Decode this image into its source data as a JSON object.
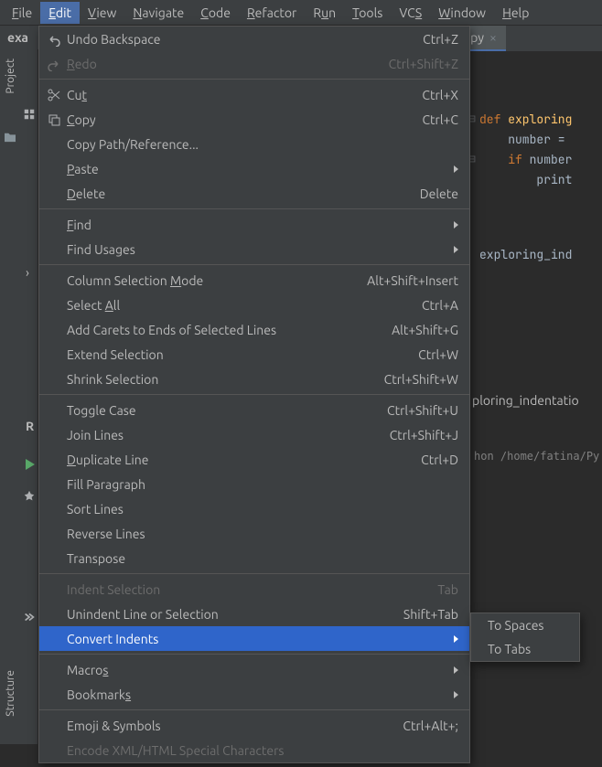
{
  "menubar": {
    "items": [
      {
        "label": "File",
        "mn": 0
      },
      {
        "label": "Edit",
        "mn": 0
      },
      {
        "label": "View",
        "mn": 0
      },
      {
        "label": "Navigate",
        "mn": 0
      },
      {
        "label": "Code",
        "mn": 0
      },
      {
        "label": "Refactor",
        "mn": 0
      },
      {
        "label": "Run",
        "mn": 1
      },
      {
        "label": "Tools",
        "mn": 0
      },
      {
        "label": "VCS",
        "mn": 2
      },
      {
        "label": "Window",
        "mn": 0
      },
      {
        "label": "Help",
        "mn": 0
      }
    ]
  },
  "breadcrumb": "exa",
  "sidebar": {
    "project": "Project",
    "structure": "Structure"
  },
  "tab": {
    "filename": "main.py"
  },
  "code": {
    "l1a": "def ",
    "l1b": "exploring",
    "l2": "    number = ",
    "l3a": "    if ",
    "l3b": "number",
    "l4": "        print",
    "call": "exploring_ind"
  },
  "run": {
    "label": "ploring_indentatio",
    "path": "hon /home/fatina/Py"
  },
  "edit_menu": {
    "undo": "Undo Backspace",
    "undo_sc": "Ctrl+Z",
    "redo": "Redo",
    "redo_sc": "Ctrl+Shift+Z",
    "cut": "Cut",
    "cut_sc": "Ctrl+X",
    "copy": "Copy",
    "copy_sc": "Ctrl+C",
    "copy_path": "Copy Path/Reference...",
    "paste": "Paste",
    "delete": "Delete",
    "delete_sc": "Delete",
    "find": "Find",
    "find_usages": "Find Usages",
    "col_sel": "Column Selection Mode",
    "col_sel_sc": "Alt+Shift+Insert",
    "sel_all": "Select All",
    "sel_all_sc": "Ctrl+A",
    "add_carets": "Add Carets to Ends of Selected Lines",
    "add_carets_sc": "Alt+Shift+G",
    "ext_sel": "Extend Selection",
    "ext_sel_sc": "Ctrl+W",
    "shr_sel": "Shrink Selection",
    "shr_sel_sc": "Ctrl+Shift+W",
    "toggle_case": "Toggle Case",
    "toggle_case_sc": "Ctrl+Shift+U",
    "join_lines": "Join Lines",
    "join_lines_sc": "Ctrl+Shift+J",
    "dup_line": "Duplicate Line",
    "dup_line_sc": "Ctrl+D",
    "fill_para": "Fill Paragraph",
    "sort_lines": "Sort Lines",
    "rev_lines": "Reverse Lines",
    "transpose": "Transpose",
    "indent_sel": "Indent Selection",
    "indent_sel_sc": "Tab",
    "unindent": "Unindent Line or Selection",
    "unindent_sc": "Shift+Tab",
    "conv_indents": "Convert Indents",
    "macros": "Macros",
    "bookmarks": "Bookmarks",
    "emoji": "Emoji & Symbols",
    "emoji_sc": "Ctrl+Alt+;",
    "encode": "Encode XML/HTML Special Characters"
  },
  "submenu": {
    "to_spaces": "To Spaces",
    "to_tabs": "To Tabs"
  }
}
